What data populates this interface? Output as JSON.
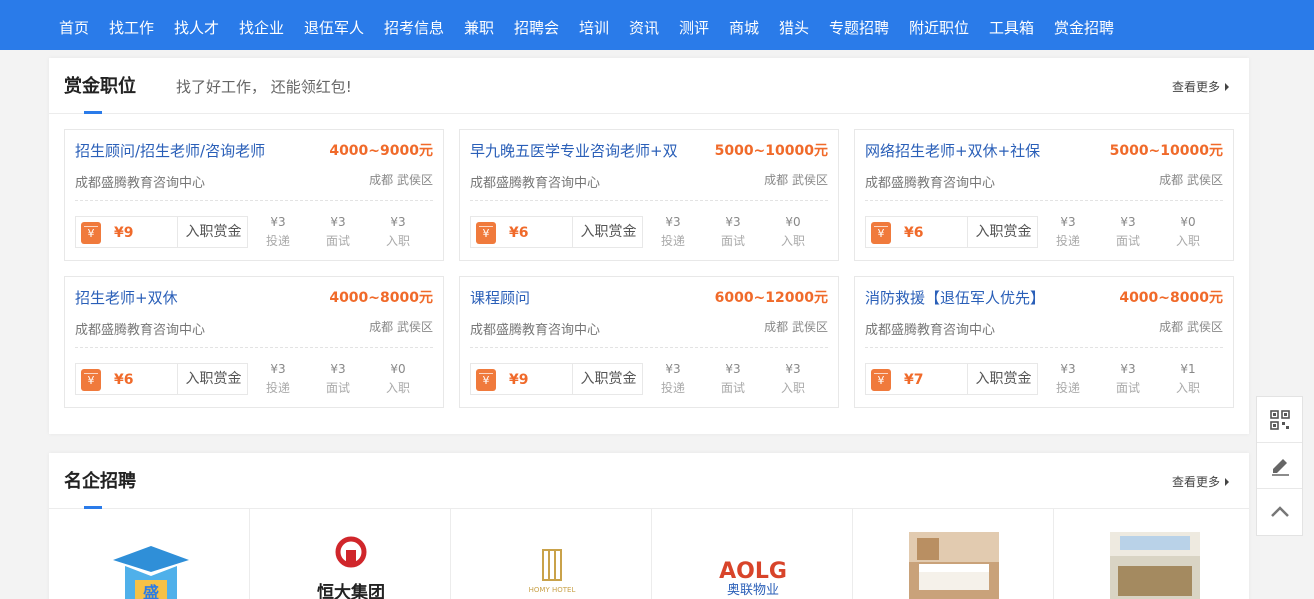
{
  "nav": [
    "首页",
    "找工作",
    "找人才",
    "找企业",
    "退伍军人",
    "招考信息",
    "兼职",
    "招聘会",
    "培训",
    "资讯",
    "测评",
    "商城",
    "猎头",
    "专题招聘",
    "附近职位",
    "工具箱",
    "赏金招聘"
  ],
  "bounty_section": {
    "title": "赏金职位",
    "subtitle": "找了好工作， 还能领红包!",
    "more": "查看更多",
    "bounty_label": "入职赏金",
    "stat_labels": [
      "投递",
      "面试",
      "入职"
    ],
    "jobs": [
      {
        "title": "招生顾问/招生老师/咨询老师",
        "salary": "4000~9000元",
        "company": "成都盛腾教育咨询中心",
        "location": "成都 武侯区",
        "bounty": "¥9",
        "stats": [
          "¥3",
          "¥3",
          "¥3"
        ]
      },
      {
        "title": "早九晚五医学专业咨询老师+双",
        "salary": "5000~10000元",
        "company": "成都盛腾教育咨询中心",
        "location": "成都 武侯区",
        "bounty": "¥6",
        "stats": [
          "¥3",
          "¥3",
          "¥0"
        ]
      },
      {
        "title": "网络招生老师+双休+社保",
        "salary": "5000~10000元",
        "company": "成都盛腾教育咨询中心",
        "location": "成都 武侯区",
        "bounty": "¥6",
        "stats": [
          "¥3",
          "¥3",
          "¥0"
        ]
      },
      {
        "title": "招生老师+双休",
        "salary": "4000~8000元",
        "company": "成都盛腾教育咨询中心",
        "location": "成都 武侯区",
        "bounty": "¥6",
        "stats": [
          "¥3",
          "¥3",
          "¥0"
        ]
      },
      {
        "title": "课程顾问",
        "salary": "6000~12000元",
        "company": "成都盛腾教育咨询中心",
        "location": "成都 武侯区",
        "bounty": "¥9",
        "stats": [
          "¥3",
          "¥3",
          "¥3"
        ]
      },
      {
        "title": "消防救援【退伍军人优先】",
        "salary": "4000~8000元",
        "company": "成都盛腾教育咨询中心",
        "location": "成都 武侯区",
        "bounty": "¥7",
        "stats": [
          "¥3",
          "¥3",
          "¥1"
        ]
      }
    ]
  },
  "famous_section": {
    "title": "名企招聘",
    "more": "查看更多",
    "companies": [
      {
        "logo": "graduation-cap-logo",
        "text": "盛"
      },
      {
        "logo": "evergrande-logo",
        "text": "恒大集团"
      },
      {
        "logo": "homy-hotel-logo",
        "text": "HOMY HOTEL"
      },
      {
        "logo": "aolg-logo",
        "text": "AOLG",
        "sub": "奥联物业"
      },
      {
        "logo": "hotel-room-photo"
      },
      {
        "logo": "hotel-lobby-photo"
      }
    ]
  },
  "side_bar": [
    "qrcode-icon",
    "edit-icon",
    "back-to-top-icon"
  ],
  "colors": {
    "accent": "#2a7be9",
    "salary": "#f06a2a",
    "title": "#2a5fb8"
  }
}
